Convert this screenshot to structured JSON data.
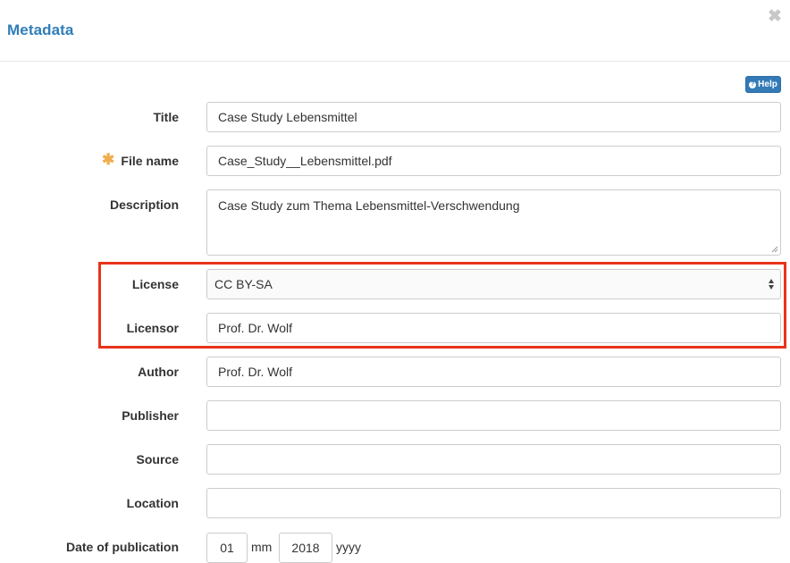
{
  "dialog": {
    "title": "Metadata",
    "close_glyph": "✖",
    "help_label": "Help"
  },
  "form": {
    "title": {
      "label": "Title",
      "value": "Case Study Lebensmittel"
    },
    "file_name": {
      "label": "File name",
      "value": "Case_Study__Lebensmittel.pdf",
      "required": true
    },
    "description": {
      "label": "Description",
      "value": "Case Study zum Thema Lebensmittel-Verschwendung"
    },
    "license": {
      "label": "License",
      "selected": "CC BY-SA"
    },
    "licensor": {
      "label": "Licensor",
      "value": "Prof. Dr. Wolf"
    },
    "author": {
      "label": "Author",
      "value": "Prof. Dr. Wolf"
    },
    "publisher": {
      "label": "Publisher",
      "value": ""
    },
    "source": {
      "label": "Source",
      "value": ""
    },
    "location": {
      "label": "Location",
      "value": ""
    },
    "date_of_publication": {
      "label": "Date of publication",
      "month": "01",
      "month_unit": "mm",
      "year": "2018",
      "year_unit": "yyyy"
    }
  },
  "colors": {
    "title_blue": "#2f7db9",
    "help_button": "#337ab7",
    "required_star": "#f0ad4e",
    "highlight_border": "#e8341c"
  }
}
